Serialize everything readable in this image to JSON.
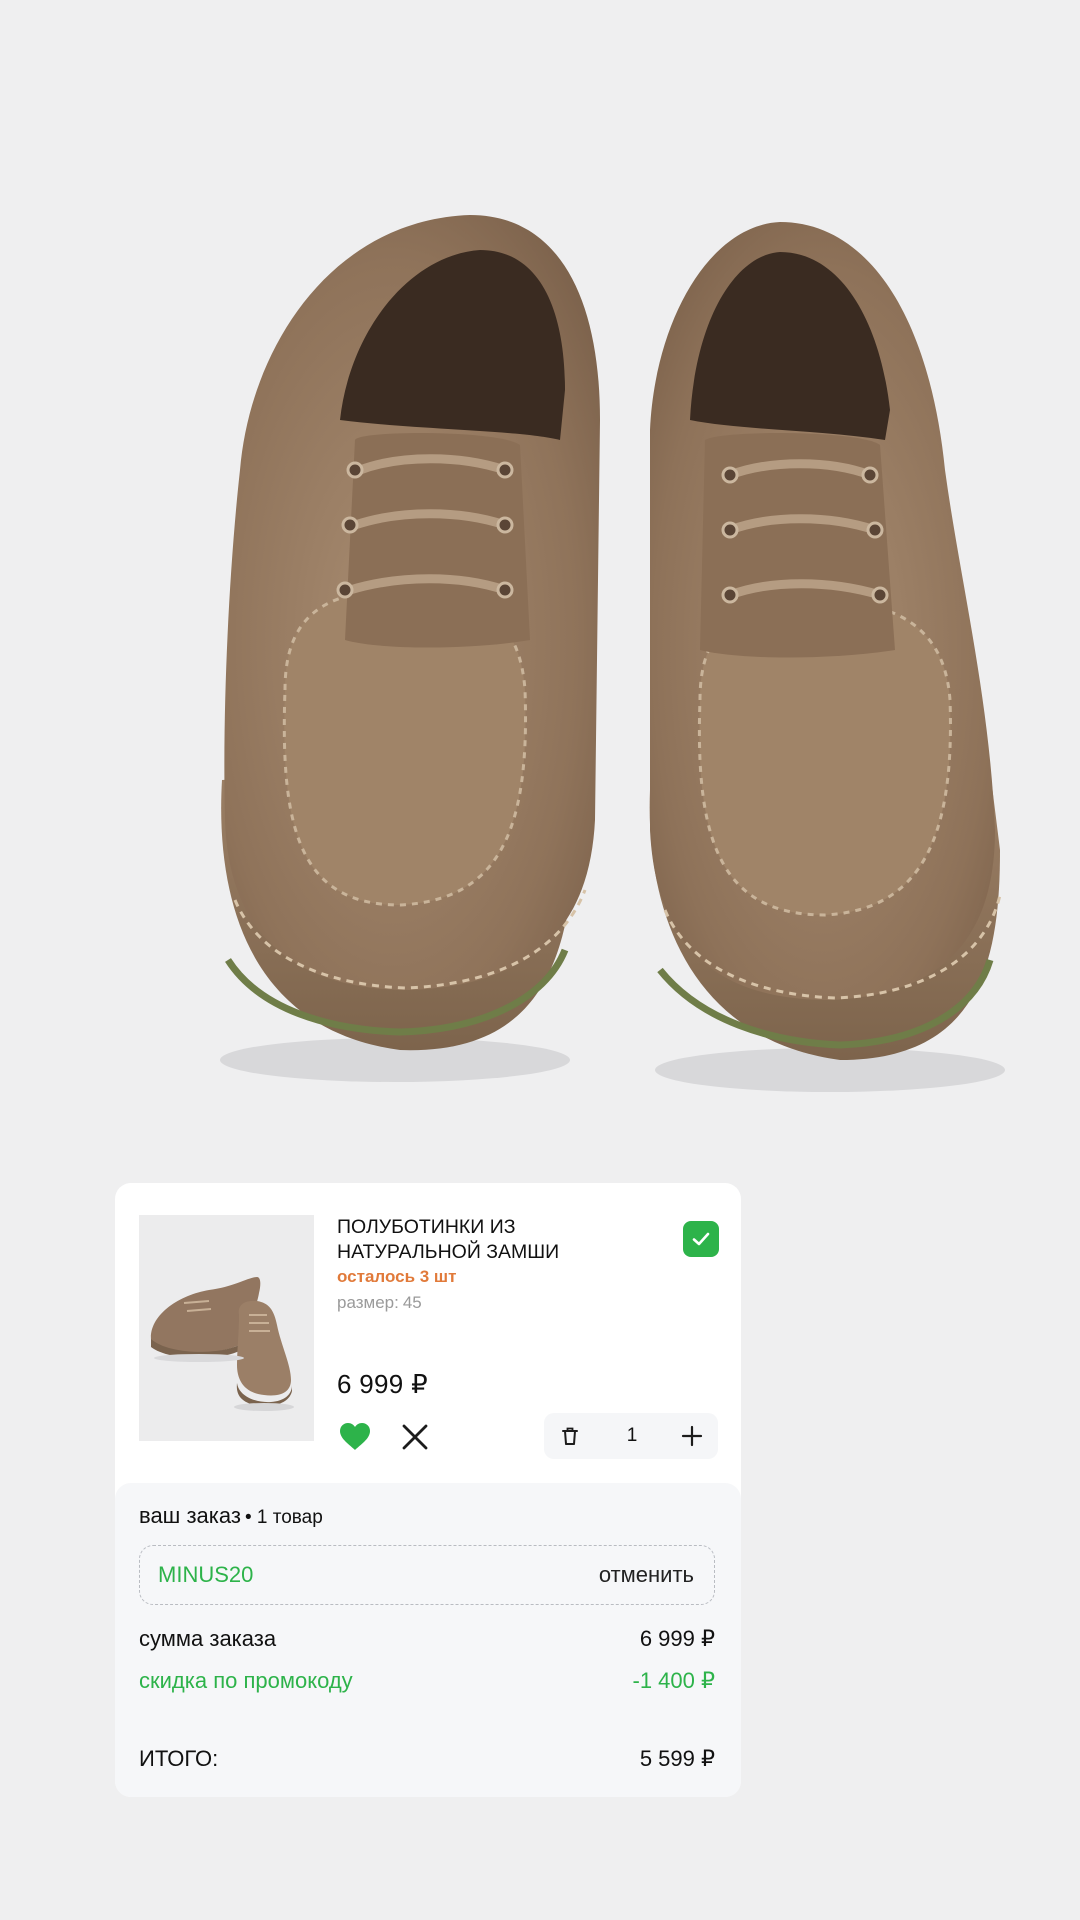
{
  "item": {
    "title_line1": "ПОЛУБОТИНКИ ИЗ",
    "title_line2": "НАТУРАЛЬНОЙ ЗАМШИ",
    "stock": "осталось 3 шт",
    "size_label": "размер:",
    "size_value": "45",
    "price": "6 999 ₽",
    "quantity": "1",
    "selected": true,
    "favorite": true
  },
  "summary": {
    "heading": "ваш заказ",
    "count": "• 1 товар",
    "promo_code": "MINUS20",
    "promo_cancel": "отменить",
    "sum_label": "сумма заказа",
    "sum_value": "6 999 ₽",
    "discount_label": "скидка по промокоду",
    "discount_value": "-1 400 ₽",
    "total_label": "ИТОГО:",
    "total_value": "5 599 ₽"
  },
  "icons": {
    "checkbox": "check-icon",
    "favorite": "heart-icon",
    "remove": "close-icon",
    "delete": "trash-icon",
    "increment": "plus-icon"
  },
  "colors": {
    "accent_green": "#2db34a",
    "stock_orange": "#e17a3a",
    "background": "#efeff0",
    "suede": "#9b7f65"
  }
}
